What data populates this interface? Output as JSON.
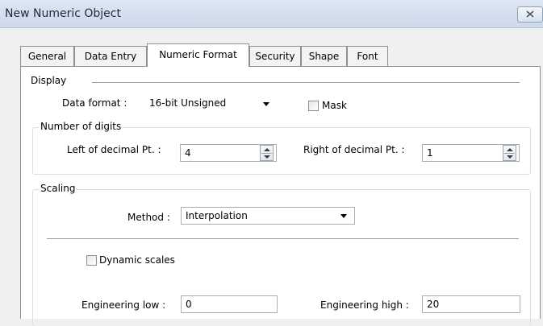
{
  "window": {
    "title": "New Numeric Object"
  },
  "tabs": [
    "General",
    "Data Entry",
    "Numeric Format",
    "Security",
    "Shape",
    "Font"
  ],
  "active_tab": "Numeric Format",
  "display": {
    "label": "Display",
    "data_format_label": "Data format :",
    "data_format_value": "16-bit Unsigned",
    "mask_label": "Mask",
    "mask_checked": false
  },
  "digits": {
    "label": "Number of digits",
    "left_label": "Left of decimal Pt. :",
    "left_value": "4",
    "right_label": "Right of decimal Pt. :",
    "right_value": "1"
  },
  "scaling": {
    "label": "Scaling",
    "method_label": "Method :",
    "method_value": "Interpolation",
    "dynamic_label": "Dynamic scales",
    "dynamic_checked": false,
    "eng_low_label": "Engineering low :",
    "eng_low_value": "0",
    "eng_high_label": "Engineering high :",
    "eng_high_value": "20"
  },
  "icons": {
    "close": "close-icon",
    "spin": "spin-updown-icon",
    "dropdown": "chevron-down-icon"
  }
}
